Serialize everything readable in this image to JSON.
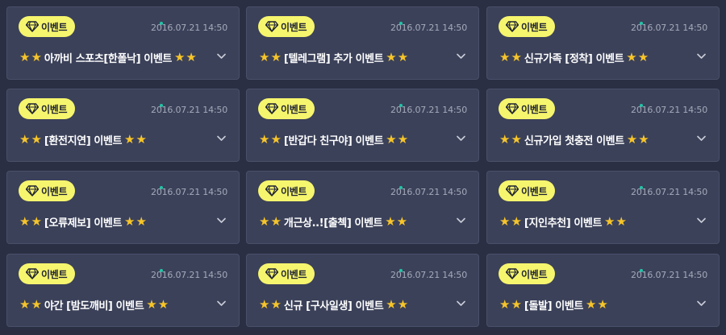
{
  "badge_label": "이벤트",
  "accent_color": "#f6f56e",
  "star_color": "#f7c52a",
  "status_dot_color": "#20c5a7",
  "cards": [
    {
      "title": "아까비 스포츠[한폴낙] 이벤트",
      "date": "2016.07.21 14:50"
    },
    {
      "title": "[텔레그램] 추가 이벤트",
      "date": "2016.07.21 14:50"
    },
    {
      "title": "신규가족 [정착] 이벤트",
      "date": "2016.07.21 14:50"
    },
    {
      "title": "[환전지연] 이벤트",
      "date": "2016.07.21 14:50"
    },
    {
      "title": "[반갑다 친구야] 이벤트",
      "date": "2016.07.21 14:50"
    },
    {
      "title": "신규가입 첫충전 이벤트",
      "date": "2016.07.21 14:50"
    },
    {
      "title": "[오류제보] 이벤트",
      "date": "2016.07.21 14:50"
    },
    {
      "title": "개근상..![출첵] 이벤트",
      "date": "2016.07.21 14:50"
    },
    {
      "title": "[지인추천] 이벤트",
      "date": "2016.07.21 14:50"
    },
    {
      "title": "야간 [밤도깨비] 이벤트",
      "date": "2016.07.21 14:50"
    },
    {
      "title": "신규 [구사일생] 이벤트",
      "date": "2016.07.21 14:50"
    },
    {
      "title": "[돌발] 이벤트",
      "date": "2016.07.21 14:50"
    }
  ]
}
